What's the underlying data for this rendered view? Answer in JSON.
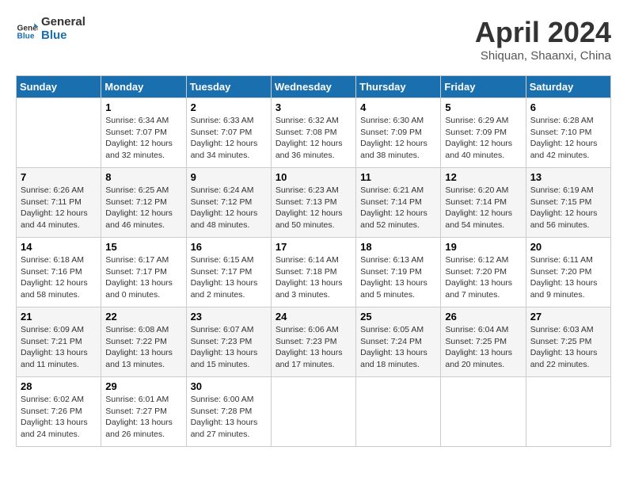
{
  "header": {
    "logo_line1": "General",
    "logo_line2": "Blue",
    "month": "April 2024",
    "location": "Shiquan, Shaanxi, China"
  },
  "days_of_week": [
    "Sunday",
    "Monday",
    "Tuesday",
    "Wednesday",
    "Thursday",
    "Friday",
    "Saturday"
  ],
  "weeks": [
    [
      {
        "num": "",
        "info": ""
      },
      {
        "num": "1",
        "info": "Sunrise: 6:34 AM\nSunset: 7:07 PM\nDaylight: 12 hours\nand 32 minutes."
      },
      {
        "num": "2",
        "info": "Sunrise: 6:33 AM\nSunset: 7:07 PM\nDaylight: 12 hours\nand 34 minutes."
      },
      {
        "num": "3",
        "info": "Sunrise: 6:32 AM\nSunset: 7:08 PM\nDaylight: 12 hours\nand 36 minutes."
      },
      {
        "num": "4",
        "info": "Sunrise: 6:30 AM\nSunset: 7:09 PM\nDaylight: 12 hours\nand 38 minutes."
      },
      {
        "num": "5",
        "info": "Sunrise: 6:29 AM\nSunset: 7:09 PM\nDaylight: 12 hours\nand 40 minutes."
      },
      {
        "num": "6",
        "info": "Sunrise: 6:28 AM\nSunset: 7:10 PM\nDaylight: 12 hours\nand 42 minutes."
      }
    ],
    [
      {
        "num": "7",
        "info": "Sunrise: 6:26 AM\nSunset: 7:11 PM\nDaylight: 12 hours\nand 44 minutes."
      },
      {
        "num": "8",
        "info": "Sunrise: 6:25 AM\nSunset: 7:12 PM\nDaylight: 12 hours\nand 46 minutes."
      },
      {
        "num": "9",
        "info": "Sunrise: 6:24 AM\nSunset: 7:12 PM\nDaylight: 12 hours\nand 48 minutes."
      },
      {
        "num": "10",
        "info": "Sunrise: 6:23 AM\nSunset: 7:13 PM\nDaylight: 12 hours\nand 50 minutes."
      },
      {
        "num": "11",
        "info": "Sunrise: 6:21 AM\nSunset: 7:14 PM\nDaylight: 12 hours\nand 52 minutes."
      },
      {
        "num": "12",
        "info": "Sunrise: 6:20 AM\nSunset: 7:14 PM\nDaylight: 12 hours\nand 54 minutes."
      },
      {
        "num": "13",
        "info": "Sunrise: 6:19 AM\nSunset: 7:15 PM\nDaylight: 12 hours\nand 56 minutes."
      }
    ],
    [
      {
        "num": "14",
        "info": "Sunrise: 6:18 AM\nSunset: 7:16 PM\nDaylight: 12 hours\nand 58 minutes."
      },
      {
        "num": "15",
        "info": "Sunrise: 6:17 AM\nSunset: 7:17 PM\nDaylight: 13 hours\nand 0 minutes."
      },
      {
        "num": "16",
        "info": "Sunrise: 6:15 AM\nSunset: 7:17 PM\nDaylight: 13 hours\nand 2 minutes."
      },
      {
        "num": "17",
        "info": "Sunrise: 6:14 AM\nSunset: 7:18 PM\nDaylight: 13 hours\nand 3 minutes."
      },
      {
        "num": "18",
        "info": "Sunrise: 6:13 AM\nSunset: 7:19 PM\nDaylight: 13 hours\nand 5 minutes."
      },
      {
        "num": "19",
        "info": "Sunrise: 6:12 AM\nSunset: 7:20 PM\nDaylight: 13 hours\nand 7 minutes."
      },
      {
        "num": "20",
        "info": "Sunrise: 6:11 AM\nSunset: 7:20 PM\nDaylight: 13 hours\nand 9 minutes."
      }
    ],
    [
      {
        "num": "21",
        "info": "Sunrise: 6:09 AM\nSunset: 7:21 PM\nDaylight: 13 hours\nand 11 minutes."
      },
      {
        "num": "22",
        "info": "Sunrise: 6:08 AM\nSunset: 7:22 PM\nDaylight: 13 hours\nand 13 minutes."
      },
      {
        "num": "23",
        "info": "Sunrise: 6:07 AM\nSunset: 7:23 PM\nDaylight: 13 hours\nand 15 minutes."
      },
      {
        "num": "24",
        "info": "Sunrise: 6:06 AM\nSunset: 7:23 PM\nDaylight: 13 hours\nand 17 minutes."
      },
      {
        "num": "25",
        "info": "Sunrise: 6:05 AM\nSunset: 7:24 PM\nDaylight: 13 hours\nand 18 minutes."
      },
      {
        "num": "26",
        "info": "Sunrise: 6:04 AM\nSunset: 7:25 PM\nDaylight: 13 hours\nand 20 minutes."
      },
      {
        "num": "27",
        "info": "Sunrise: 6:03 AM\nSunset: 7:25 PM\nDaylight: 13 hours\nand 22 minutes."
      }
    ],
    [
      {
        "num": "28",
        "info": "Sunrise: 6:02 AM\nSunset: 7:26 PM\nDaylight: 13 hours\nand 24 minutes."
      },
      {
        "num": "29",
        "info": "Sunrise: 6:01 AM\nSunset: 7:27 PM\nDaylight: 13 hours\nand 26 minutes."
      },
      {
        "num": "30",
        "info": "Sunrise: 6:00 AM\nSunset: 7:28 PM\nDaylight: 13 hours\nand 27 minutes."
      },
      {
        "num": "",
        "info": ""
      },
      {
        "num": "",
        "info": ""
      },
      {
        "num": "",
        "info": ""
      },
      {
        "num": "",
        "info": ""
      }
    ]
  ]
}
